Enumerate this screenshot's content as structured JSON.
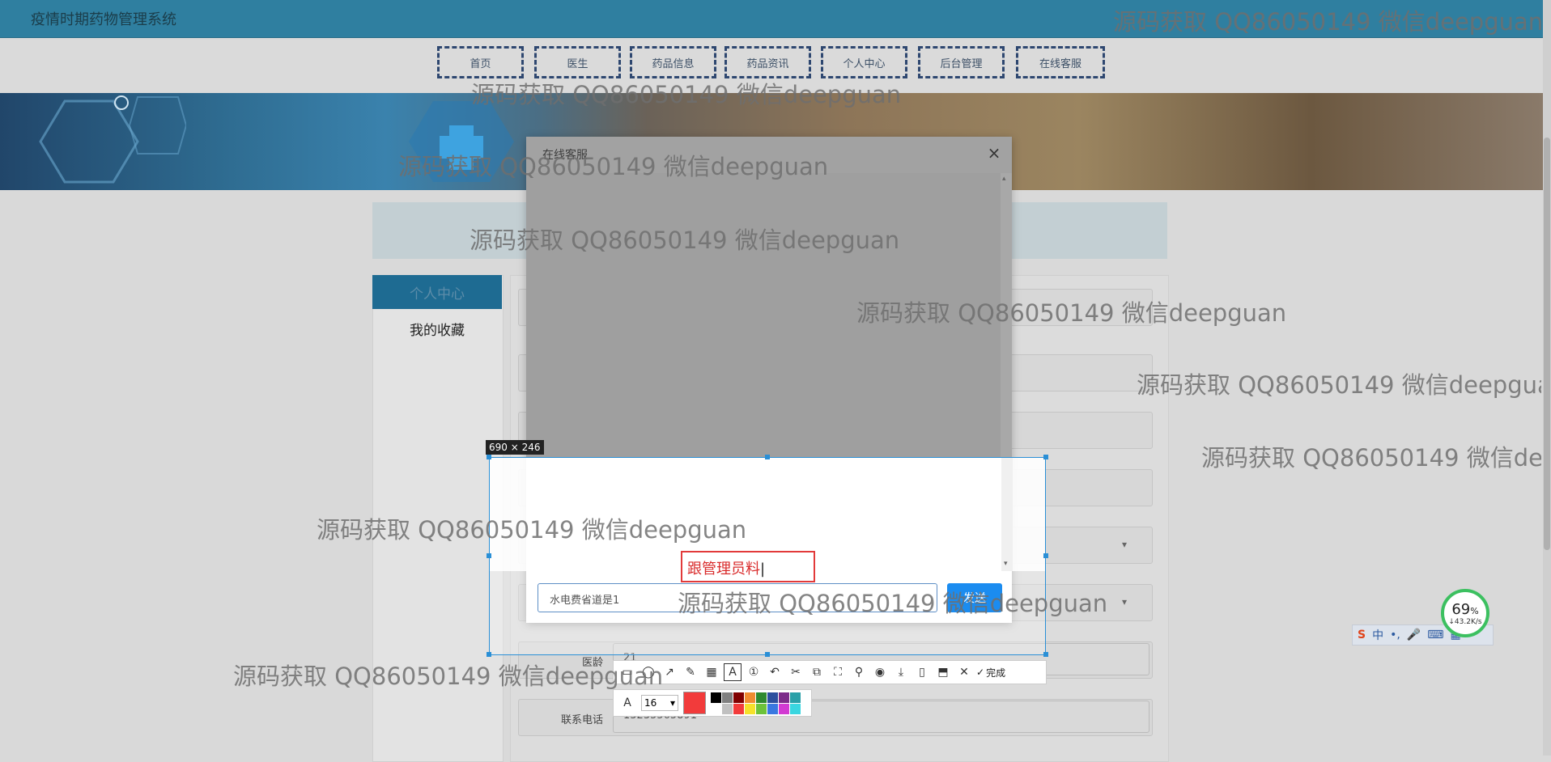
{
  "app": {
    "title": "疫情时期药物管理系统"
  },
  "nav": {
    "items": [
      "首页",
      "医生",
      "药品信息",
      "药品资讯",
      "个人中心",
      "后台管理",
      "在线客服"
    ]
  },
  "sidebar": {
    "active": "个人中心",
    "link": "我的收藏"
  },
  "form": {
    "fields": [
      {
        "label": "医龄",
        "value": "21"
      },
      {
        "label": "联系电话",
        "value": "13235565891"
      }
    ]
  },
  "modal": {
    "title": "在线客服",
    "close_glyph": "×",
    "input_value": "水电费省道是1",
    "send_label": "发送"
  },
  "snip": {
    "size_label": "690 × 246",
    "annotation_text": "跟管理员料",
    "done_label": "完成",
    "font_size": "16",
    "current_color": "#f23b3b",
    "palette": [
      "#000000",
      "#808080",
      "#800000",
      "#f08c30",
      "#2f8a2f",
      "#2c4f9e",
      "#7d2c8a",
      "#2aa0a8",
      "#ffffff",
      "#c0c0c0",
      "#f23b3b",
      "#f5e12a",
      "#6cc23a",
      "#3a78e0",
      "#d23ad2",
      "#3ad6e0"
    ]
  },
  "widgets": {
    "battery_pct": "69",
    "battery_unit": "%",
    "net_speed": "↓43.2K/s",
    "ime_logo": "S",
    "ime_lang": "中"
  },
  "watermark": "源码获取 QQ86050149 微信deepguan"
}
